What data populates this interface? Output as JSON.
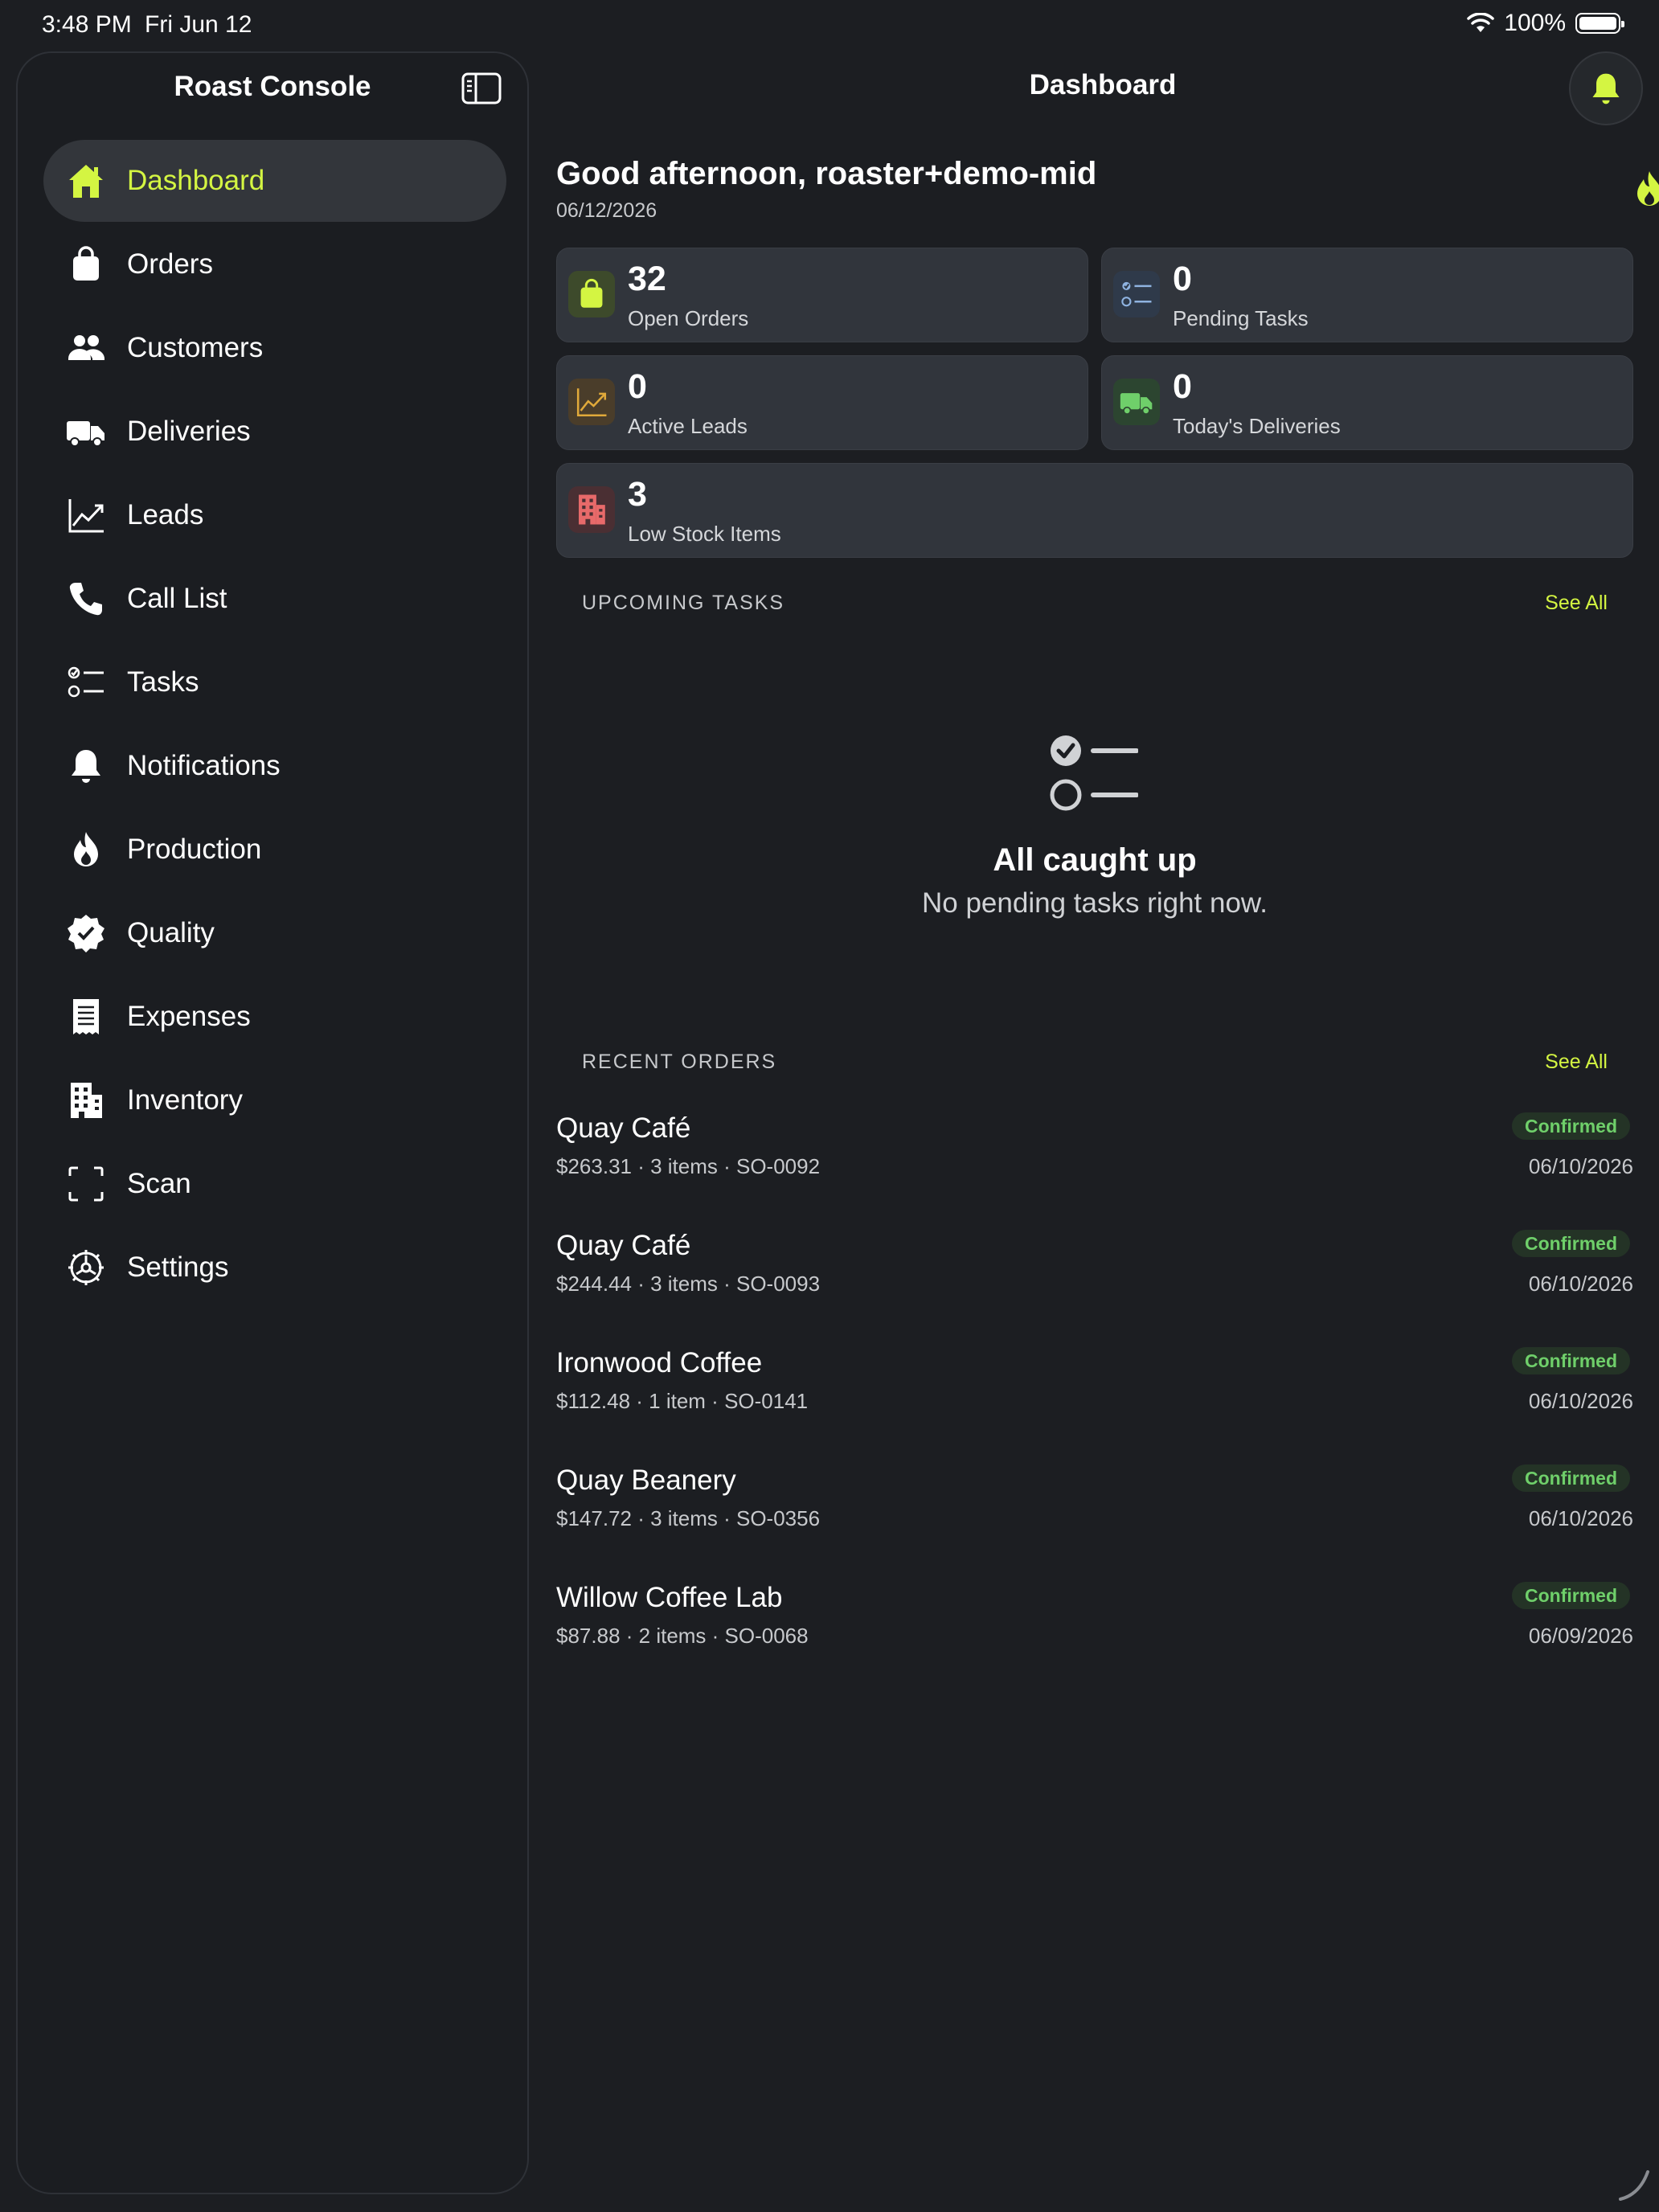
{
  "status_bar": {
    "time": "3:48 PM",
    "date": "Fri Jun 12",
    "battery": "100%"
  },
  "sidebar": {
    "title": "Roast Console",
    "items": [
      {
        "label": "Dashboard",
        "icon": "home-icon",
        "active": true
      },
      {
        "label": "Orders",
        "icon": "bag-icon"
      },
      {
        "label": "Customers",
        "icon": "people-icon"
      },
      {
        "label": "Deliveries",
        "icon": "truck-icon"
      },
      {
        "label": "Leads",
        "icon": "chart-line-icon"
      },
      {
        "label": "Call List",
        "icon": "phone-icon"
      },
      {
        "label": "Tasks",
        "icon": "checklist-icon"
      },
      {
        "label": "Notifications",
        "icon": "bell-icon"
      },
      {
        "label": "Production",
        "icon": "flame-icon"
      },
      {
        "label": "Quality",
        "icon": "checkmark-seal-icon"
      },
      {
        "label": "Expenses",
        "icon": "receipt-icon"
      },
      {
        "label": "Inventory",
        "icon": "building-icon"
      },
      {
        "label": "Scan",
        "icon": "scan-icon"
      },
      {
        "label": "Settings",
        "icon": "gear-icon"
      }
    ]
  },
  "header": {
    "title": "Dashboard"
  },
  "greeting": {
    "text": "Good afternoon, roaster+demo-mid",
    "date": "06/12/2026"
  },
  "stats": [
    {
      "value": "32",
      "label": "Open Orders",
      "icon": "bag-icon",
      "color": "#d4f542"
    },
    {
      "value": "0",
      "label": "Pending Tasks",
      "icon": "checklist-icon",
      "color": "#8fb3e0"
    },
    {
      "value": "0",
      "label": "Active Leads",
      "icon": "chart-line-icon",
      "color": "#e0a93a"
    },
    {
      "value": "0",
      "label": "Today's Deliveries",
      "icon": "truck-icon",
      "color": "#6fcf6a"
    },
    {
      "value": "3",
      "label": "Low Stock Items",
      "icon": "building-icon",
      "color": "#e86a6a"
    }
  ],
  "tasks": {
    "header": "UPCOMING TASKS",
    "see_all": "See All",
    "empty_title": "All caught up",
    "empty_sub": "No pending tasks right now."
  },
  "orders": {
    "header": "RECENT ORDERS",
    "see_all": "See All",
    "rows": [
      {
        "name": "Quay Café",
        "meta": "$263.31 · 3 items · SO-0092",
        "status": "Confirmed",
        "date": "06/10/2026"
      },
      {
        "name": "Quay Café",
        "meta": "$244.44 · 3 items · SO-0093",
        "status": "Confirmed",
        "date": "06/10/2026"
      },
      {
        "name": "Ironwood Coffee",
        "meta": "$112.48 · 1 item · SO-0141",
        "status": "Confirmed",
        "date": "06/10/2026"
      },
      {
        "name": "Quay Beanery",
        "meta": "$147.72 · 3 items · SO-0356",
        "status": "Confirmed",
        "date": "06/10/2026"
      },
      {
        "name": "Willow Coffee Lab",
        "meta": "$87.88 · 2 items · SO-0068",
        "status": "Confirmed",
        "date": "06/09/2026"
      }
    ]
  },
  "colors": {
    "accent": "#d4f542",
    "confirmed": "#6fcf6a",
    "background": "#1c1e22",
    "card": "#31353c"
  }
}
